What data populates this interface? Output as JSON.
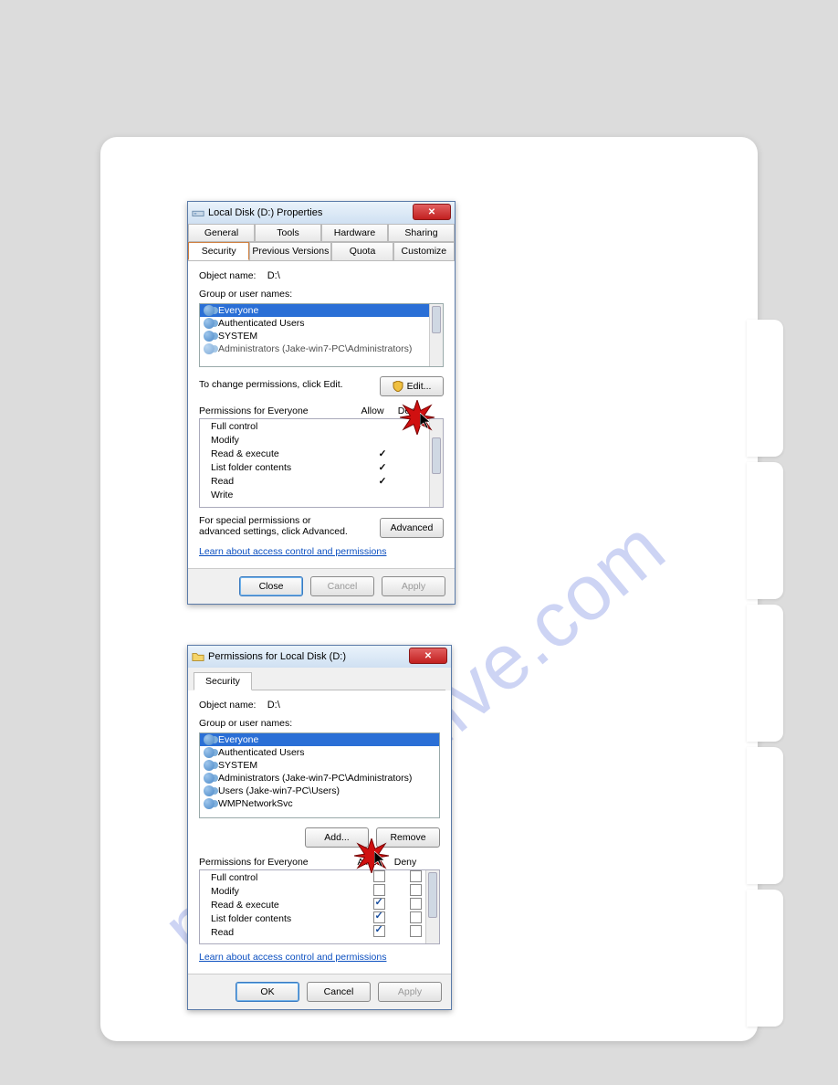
{
  "watermark": "manualshive.com",
  "dialog1": {
    "title": "Local Disk (D:) Properties",
    "tabs_row1": [
      "General",
      "Tools",
      "Hardware",
      "Sharing"
    ],
    "tabs_row2": [
      "Security",
      "Previous Versions",
      "Quota",
      "Customize"
    ],
    "active_tab": "Security",
    "object_name_label": "Object name:",
    "object_name_value": "D:\\",
    "group_label": "Group or user names:",
    "groups": [
      "Everyone",
      "Authenticated Users",
      "SYSTEM",
      "Administrators (Jake-win7-PC\\Administrators)"
    ],
    "selected_group_index": 0,
    "change_hint": "To change permissions, click Edit.",
    "edit_button": "Edit...",
    "perm_header": "Permissions for Everyone",
    "perm_allow": "Allow",
    "perm_deny": "Deny",
    "permissions": [
      {
        "name": "Full control",
        "allow": false
      },
      {
        "name": "Modify",
        "allow": false
      },
      {
        "name": "Read & execute",
        "allow": true
      },
      {
        "name": "List folder contents",
        "allow": true
      },
      {
        "name": "Read",
        "allow": true
      },
      {
        "name": "Write",
        "allow": false
      }
    ],
    "adv_hint": "For special permissions or advanced settings, click Advanced.",
    "advanced_button": "Advanced",
    "learn_link": "Learn about access control and permissions",
    "close_button": "Close",
    "cancel_button": "Cancel",
    "apply_button": "Apply"
  },
  "dialog2": {
    "title": "Permissions for Local Disk (D:)",
    "tab": "Security",
    "object_name_label": "Object name:",
    "object_name_value": "D:\\",
    "group_label": "Group or user names:",
    "groups": [
      "Everyone",
      "Authenticated Users",
      "SYSTEM",
      "Administrators (Jake-win7-PC\\Administrators)",
      "Users (Jake-win7-PC\\Users)",
      "WMPNetworkSvc"
    ],
    "selected_group_index": 0,
    "add_button": "Add...",
    "remove_button": "Remove",
    "perm_header": "Permissions for Everyone",
    "perm_allow": "Allow",
    "perm_deny": "Deny",
    "permissions": [
      {
        "name": "Full control",
        "allow": false,
        "deny": false
      },
      {
        "name": "Modify",
        "allow": false,
        "deny": false
      },
      {
        "name": "Read & execute",
        "allow": true,
        "deny": false
      },
      {
        "name": "List folder contents",
        "allow": true,
        "deny": false
      },
      {
        "name": "Read",
        "allow": true,
        "deny": false
      }
    ],
    "learn_link": "Learn about access control and permissions",
    "ok_button": "OK",
    "cancel_button": "Cancel",
    "apply_button": "Apply"
  }
}
